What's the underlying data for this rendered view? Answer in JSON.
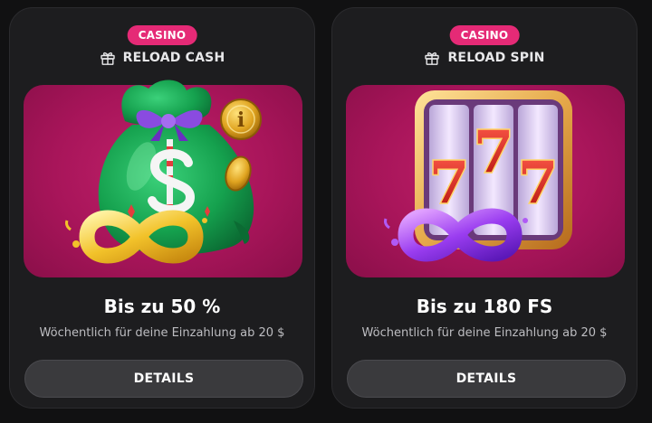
{
  "cards": [
    {
      "badge": "CASINO",
      "type_icon": "gift-icon",
      "type_label": "RELOAD CASH",
      "image": "money-bag-infinity-illustration",
      "title": "Bis zu 50 %",
      "subtitle": "Wöchentlich für deine Einzahlung ab 20 $",
      "button_label": "DETAILS"
    },
    {
      "badge": "CASINO",
      "type_icon": "gift-icon",
      "type_label": "RELOAD SPIN",
      "image": "slot-777-infinity-illustration",
      "title": "Bis zu 180 FS",
      "subtitle": "Wöchentlich für deine Einzahlung ab 20 $",
      "button_label": "DETAILS"
    }
  ],
  "colors": {
    "badge": "#e52a76",
    "card_bg": "#1d1d1f",
    "art_bg": "#b0185f",
    "button_bg": "#3a3a3d"
  }
}
